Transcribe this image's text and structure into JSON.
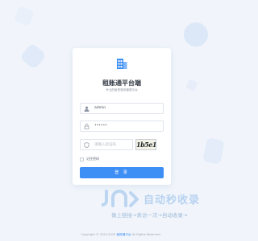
{
  "app": {
    "title": "租账通平台端",
    "subtitle": "专业的租赁账务管理平台"
  },
  "login_form": {
    "username_value": "admin",
    "password_value": "••••••",
    "captcha_placeholder": "请输入验证码",
    "captcha_text": "1b5e1",
    "remember_label": "记住密码",
    "submit_label": "登 录"
  },
  "watermark": {
    "title": "自动秒收录",
    "subtitle": "做上链接→来访一次→自动收录→"
  },
  "footer": {
    "prefix": "Copyright © 2024-2025",
    "brand": "租账通平台",
    "suffix": "All Rights Reserved."
  },
  "colors": {
    "primary": "#3d8ef5",
    "background": "#f1f5fb",
    "card": "#ffffff"
  }
}
